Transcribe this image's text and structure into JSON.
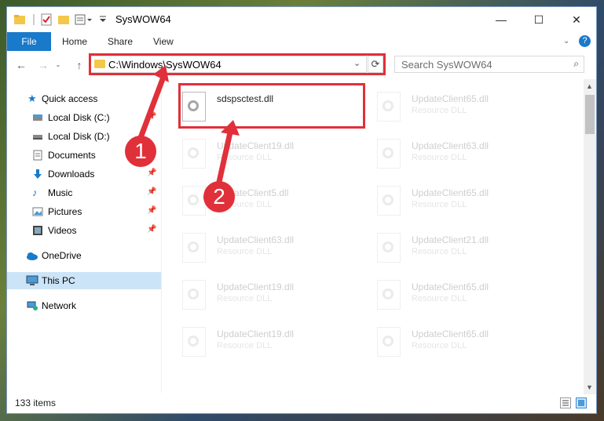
{
  "window": {
    "title": "SysWOW64",
    "minimize": "—",
    "maximize": "☐",
    "close": "✕"
  },
  "ribbon": {
    "file": "File",
    "tabs": [
      "Home",
      "Share",
      "View"
    ],
    "help": "?"
  },
  "nav": {
    "back": "←",
    "forward": "→",
    "up": "↑",
    "address": "C:\\Windows\\SysWOW64",
    "refresh": "⟳",
    "search_placeholder": "Search SysWOW64",
    "search_icon": "⌕"
  },
  "sidebar": {
    "items": [
      {
        "label": "Quick access",
        "icon": "star-icon"
      },
      {
        "label": "Local Disk (C:)",
        "icon": "drive-icon"
      },
      {
        "label": "Local Disk (D:)",
        "icon": "drive-icon"
      },
      {
        "label": "Documents",
        "icon": "documents-icon"
      },
      {
        "label": "Downloads",
        "icon": "downloads-icon"
      },
      {
        "label": "Music",
        "icon": "music-icon"
      },
      {
        "label": "Pictures",
        "icon": "pictures-icon"
      },
      {
        "label": "Videos",
        "icon": "videos-icon"
      },
      {
        "label": "OneDrive",
        "icon": "onedrive-icon"
      },
      {
        "label": "This PC",
        "icon": "pc-icon"
      },
      {
        "label": "Network",
        "icon": "network-icon"
      }
    ]
  },
  "files": [
    {
      "name": "sdspsctest.dll",
      "type": ""
    },
    {
      "name": "UpdateClient65.dll",
      "type": "Resource DLL"
    },
    {
      "name": "UpdateClient19.dll",
      "type": "Resource DLL"
    },
    {
      "name": "UpdateClient63.dll",
      "type": "Resource DLL"
    },
    {
      "name": "UpdateClient5.dll",
      "type": "Resource DLL"
    },
    {
      "name": "UpdateClient65.dll",
      "type": "Resource DLL"
    },
    {
      "name": "UpdateClient63.dll",
      "type": "Resource DLL"
    },
    {
      "name": "UpdateClient21.dll",
      "type": "Resource DLL"
    },
    {
      "name": "UpdateClient19.dll",
      "type": "Resource DLL"
    },
    {
      "name": "UpdateClient65.dll",
      "type": "Resource DLL"
    },
    {
      "name": "UpdateClient19.dll",
      "type": "Resource DLL"
    },
    {
      "name": "UpdateClient65.dll",
      "type": "Resource DLL"
    }
  ],
  "status": {
    "count": "133 items"
  },
  "callouts": {
    "one": "1",
    "two": "2"
  },
  "colors": {
    "accent": "#1979ca",
    "highlight": "#e0303a",
    "selected": "#cce4f7"
  }
}
